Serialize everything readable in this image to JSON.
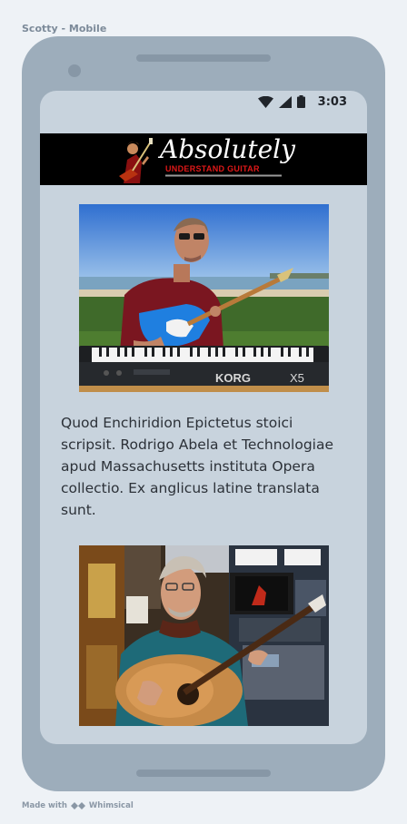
{
  "frame": {
    "title": "Scotty - Mobile"
  },
  "status_bar": {
    "time": "3:03",
    "icons": [
      "wifi-icon",
      "signal-icon",
      "battery-icon"
    ]
  },
  "banner": {
    "title": "Absolutely",
    "subtitle": "UNDERSTAND GUITAR"
  },
  "content": {
    "paragraph": "Quod Enchiridion Epictetus stoici scripsit. Rodrigo Abela et Technologiae apud Massachusetts instituta Opera collectio. Ex anglicus latine translata sunt."
  },
  "photo_1": {
    "keyboard_brand": "KORG",
    "keyboard_model": "X5"
  },
  "footer": {
    "made_with": "Made with",
    "brand": "Whimsical"
  },
  "colors": {
    "page_bg": "#eef2f6",
    "phone": "#9dadbb",
    "screen": "#c8d3dd",
    "banner_bg": "#000000",
    "banner_accent": "#e01818"
  }
}
